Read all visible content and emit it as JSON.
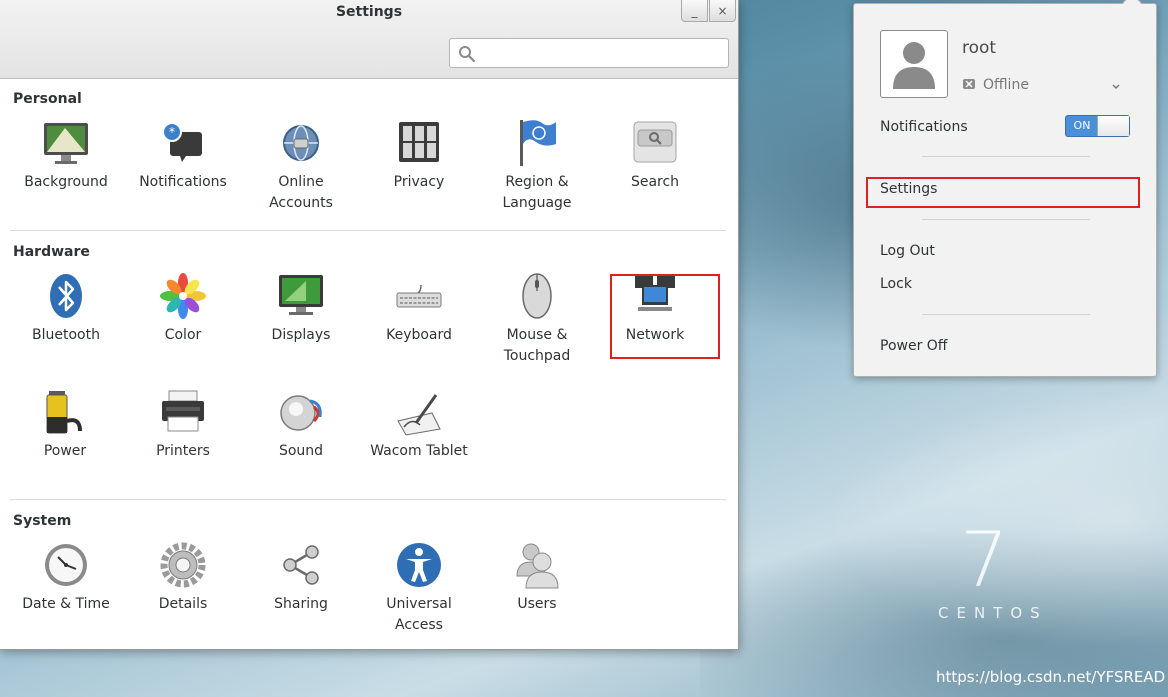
{
  "window": {
    "title": "Settings",
    "minimize_label": "_",
    "close_label": "×",
    "search": {
      "placeholder": "",
      "value": ""
    }
  },
  "sections": {
    "personal": {
      "title": "Personal",
      "items": [
        {
          "label": "Background",
          "icon": "background-icon"
        },
        {
          "label": "Notifications",
          "icon": "notifications-icon"
        },
        {
          "label": "Online\nAccounts",
          "icon": "online-accounts-icon"
        },
        {
          "label": "Privacy",
          "icon": "privacy-icon"
        },
        {
          "label": "Region &\nLanguage",
          "icon": "region-language-icon"
        },
        {
          "label": "Search",
          "icon": "search-settings-icon"
        }
      ]
    },
    "hardware": {
      "title": "Hardware",
      "items": [
        {
          "label": "Bluetooth",
          "icon": "bluetooth-icon"
        },
        {
          "label": "Color",
          "icon": "color-icon"
        },
        {
          "label": "Displays",
          "icon": "displays-icon"
        },
        {
          "label": "Keyboard",
          "icon": "keyboard-icon"
        },
        {
          "label": "Mouse &\nTouchpad",
          "icon": "mouse-icon"
        },
        {
          "label": "Network",
          "icon": "network-icon"
        },
        {
          "label": "Power",
          "icon": "power-icon"
        },
        {
          "label": "Printers",
          "icon": "printers-icon"
        },
        {
          "label": "Sound",
          "icon": "sound-icon"
        },
        {
          "label": "Wacom Tablet",
          "icon": "wacom-tablet-icon"
        }
      ]
    },
    "system": {
      "title": "System",
      "items": [
        {
          "label": "Date & Time",
          "icon": "clock-icon"
        },
        {
          "label": "Details",
          "icon": "gear-icon"
        },
        {
          "label": "Sharing",
          "icon": "share-icon"
        },
        {
          "label": "Universal\nAccess",
          "icon": "accessibility-icon"
        },
        {
          "label": "Users",
          "icon": "users-icon"
        }
      ]
    }
  },
  "system_menu": {
    "username": "root",
    "status": "Offline",
    "notifications_label": "Notifications",
    "notifications_toggle": "ON",
    "settings_label": "Settings",
    "logout_label": "Log Out",
    "lock_label": "Lock",
    "poweroff_label": "Power Off"
  },
  "desktop": {
    "brand_number": "7",
    "brand_word": "CENTOS",
    "watermark": "https://blog.csdn.net/YFSREAD"
  },
  "colors": {
    "highlight": "#e02020",
    "toggle_on": "#4a90d9"
  }
}
